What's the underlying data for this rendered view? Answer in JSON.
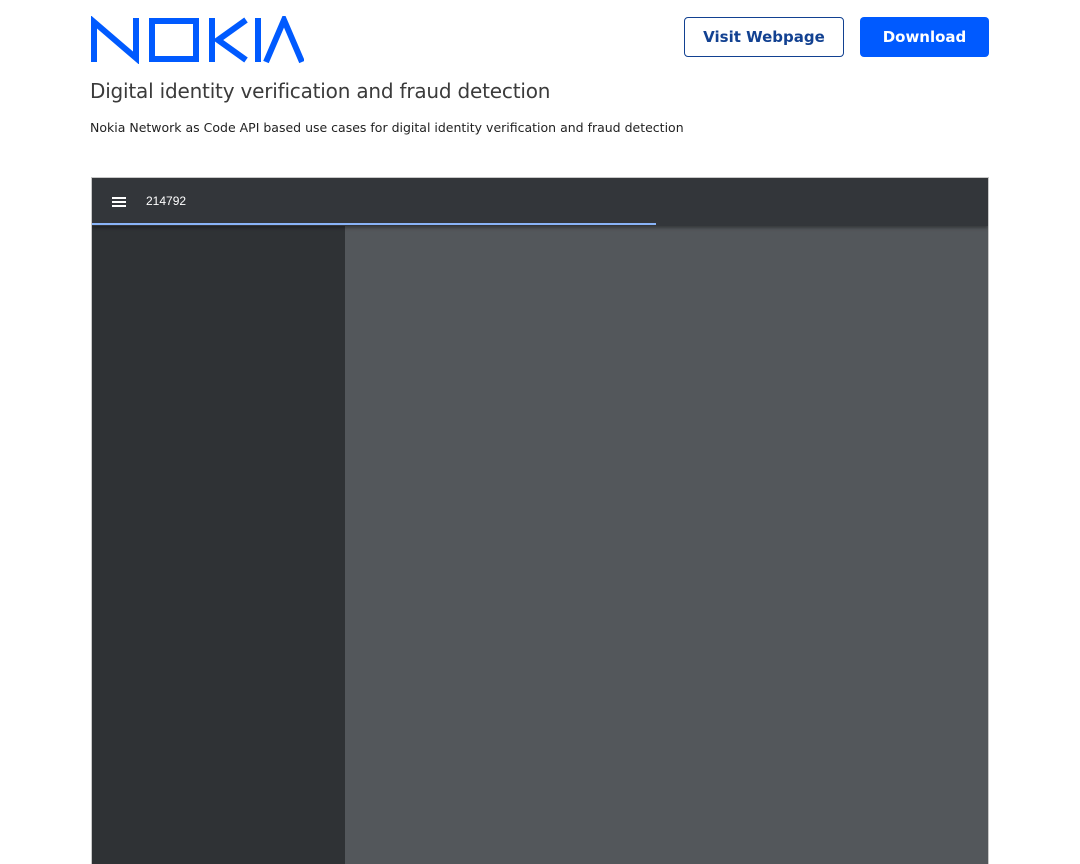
{
  "header": {
    "logo_text": "NOKIA",
    "visit_button_label": "Visit Webpage",
    "download_button_label": "Download"
  },
  "page": {
    "title": "Digital identity verification and fraud detection",
    "description": "Nokia Network as Code API based use cases for digital identity verification and fraud detection"
  },
  "viewer": {
    "document_title": "214792",
    "load_progress": 0.63,
    "menu_icon": "hamburger-menu-icon"
  },
  "colors": {
    "brand_blue": "#005aff",
    "outline_blue": "#124191",
    "appbar_bg": "#33363a",
    "sidebar_bg": "#2f3235",
    "content_bg": "#53575b",
    "progress": "#8ab4f8"
  }
}
